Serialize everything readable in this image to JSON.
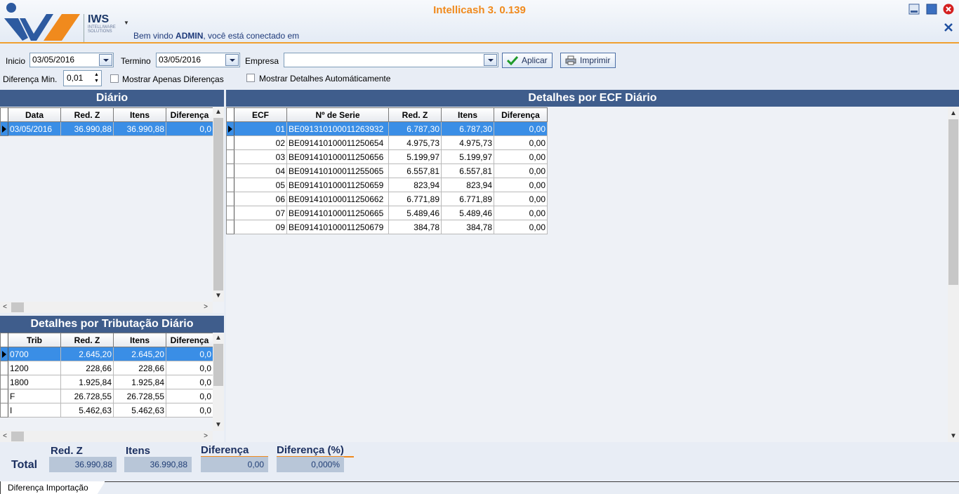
{
  "app": {
    "title": "Intellicash 3. 0.139",
    "welcome_prefix": "Bem vindo",
    "user": "ADMIN",
    "welcome_suffix": ", você está conectado em",
    "logo_big": "IWS",
    "logo_small1": "INTELLIWARE",
    "logo_small2": "SOLUTIONS"
  },
  "filters": {
    "inicio_label": "Inicio",
    "inicio_value": "03/05/2016",
    "termino_label": "Termino",
    "termino_value": "03/05/2016",
    "empresa_label": "Empresa",
    "empresa_value": "",
    "aplicar_label": "Aplicar",
    "imprimir_label": "Imprimir",
    "diferenca_label": "Diferença Min.",
    "diferenca_value": "0,01",
    "check_diferencas": "Mostrar Apenas Diferenças",
    "check_detalhes": "Mostrar Detalhes Automáticamente"
  },
  "diario": {
    "title": "Diário",
    "columns": [
      "Data",
      "Red. Z",
      "Itens",
      "Diferença"
    ],
    "rows": [
      [
        "03/05/2016",
        "36.990,88",
        "36.990,88",
        "0,0"
      ]
    ]
  },
  "tributacao": {
    "title": "Detalhes por Tributação Diário",
    "columns": [
      "Trib",
      "Red. Z",
      "Itens",
      "Diferença"
    ],
    "rows": [
      [
        "0700",
        "2.645,20",
        "2.645,20",
        "0,0"
      ],
      [
        "1200",
        "228,66",
        "228,66",
        "0,0"
      ],
      [
        "1800",
        "1.925,84",
        "1.925,84",
        "0,0"
      ],
      [
        "F",
        "26.728,55",
        "26.728,55",
        "0,0"
      ],
      [
        "I",
        "5.462,63",
        "5.462,63",
        "0,0"
      ]
    ]
  },
  "ecf": {
    "title": "Detalhes por ECF Diário",
    "columns": [
      "ECF",
      "Nº de Serie",
      "Red. Z",
      "Itens",
      "Diferença"
    ],
    "rows": [
      [
        "01",
        "BE091310100011263932",
        "6.787,30",
        "6.787,30",
        "0,00"
      ],
      [
        "02",
        "BE091410100011250654",
        "4.975,73",
        "4.975,73",
        "0,00"
      ],
      [
        "03",
        "BE091410100011250656",
        "5.199,97",
        "5.199,97",
        "0,00"
      ],
      [
        "04",
        "BE091410100011255065",
        "6.557,81",
        "6.557,81",
        "0,00"
      ],
      [
        "05",
        "BE091410100011250659",
        "823,94",
        "823,94",
        "0,00"
      ],
      [
        "06",
        "BE091410100011250662",
        "6.771,89",
        "6.771,89",
        "0,00"
      ],
      [
        "07",
        "BE091410100011250665",
        "5.489,46",
        "5.489,46",
        "0,00"
      ],
      [
        "09",
        "BE091410100011250679",
        "384,78",
        "384,78",
        "0,00"
      ]
    ]
  },
  "totals": {
    "label": "Total",
    "redz_label": "Red. Z",
    "redz_value": "36.990,88",
    "itens_label": "Itens",
    "itens_value": "36.990,88",
    "dif_label": "Diferença",
    "dif_value": "0,00",
    "difpct_label": "Diferença (%)",
    "difpct_value": "0,000%"
  },
  "tabs": {
    "active": "Diferença Importação"
  },
  "colors": {
    "accent": "#f08a1d",
    "panel_header": "#3f5d8c",
    "selection": "#3a8ee6"
  }
}
